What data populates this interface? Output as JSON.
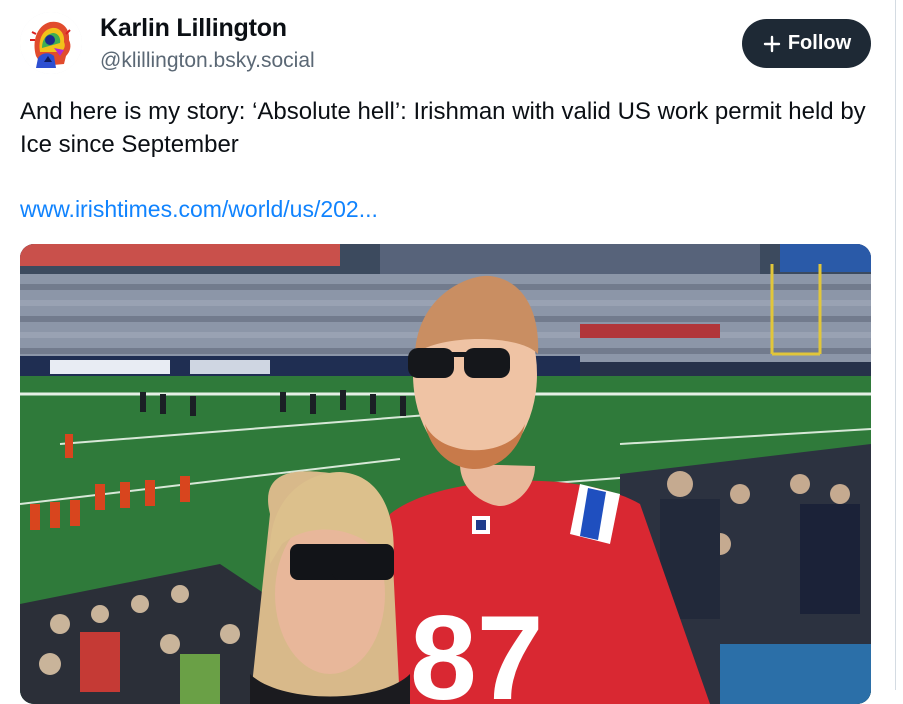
{
  "post": {
    "author_name": "Karlin Lillington",
    "handle": "@klillington.bsky.social",
    "avatar_icon": "avatar-icon",
    "follow_label": "Follow",
    "follow_icon": "plus-icon",
    "text": "And here is my story: ‘Absolute hell’: Irishman with valid US work permit held by Ice since September",
    "link_text": "www.irishtimes.com/world/us/202...",
    "image_alt": "photo-of-couple-at-football-stadium"
  },
  "theme": {
    "button_bg": "#1e2935",
    "link_color": "#1083fe",
    "handle_color": "#5b6875"
  }
}
